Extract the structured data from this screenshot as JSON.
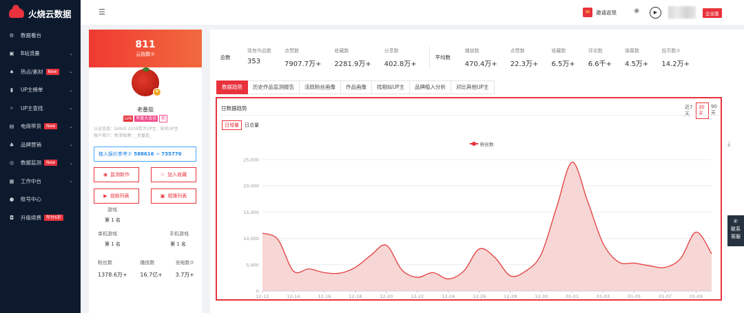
{
  "brand": {
    "name": "火烧云数据"
  },
  "sidebar": {
    "items": [
      {
        "icon": "dashboard-icon",
        "glyph": "⚙",
        "label": "数据看台",
        "chevron": false,
        "badge": ""
      },
      {
        "icon": "bilibili-icon",
        "glyph": "▣",
        "label": "B站流量",
        "chevron": true,
        "badge": ""
      },
      {
        "icon": "fire-icon",
        "glyph": "♠",
        "label": "热点/素材",
        "chevron": true,
        "badge": "New"
      },
      {
        "icon": "bar-chart-icon",
        "glyph": "▮",
        "label": "UP主榜单",
        "chevron": true,
        "badge": ""
      },
      {
        "icon": "search-icon",
        "glyph": "⌕",
        "label": "UP主查找",
        "chevron": true,
        "badge": ""
      },
      {
        "icon": "cart-icon",
        "glyph": "▤",
        "label": "电商带货",
        "chevron": true,
        "badge": "New"
      },
      {
        "icon": "brand-icon",
        "glyph": "♣",
        "label": "品牌营销",
        "chevron": true,
        "badge": ""
      },
      {
        "icon": "monitor-icon",
        "glyph": "◎",
        "label": "数据监测",
        "chevron": true,
        "badge": "New"
      },
      {
        "icon": "grid-icon",
        "glyph": "▦",
        "label": "工作中台",
        "chevron": true,
        "badge": ""
      },
      {
        "icon": "user-icon",
        "glyph": "●",
        "label": "账号中心",
        "chevron": false,
        "badge": ""
      },
      {
        "icon": "upgrade-icon",
        "glyph": "◘",
        "label": "升级续费",
        "chevron": false,
        "badge": "年付6折"
      }
    ]
  },
  "topbar": {
    "menu_glyph": "☰",
    "invite_label": "邀请返现",
    "gift_glyph": "✉",
    "palette_glyph": "❀",
    "avatar_glyph": "▶",
    "enterprise_label": "企业版"
  },
  "profile": {
    "fans_value": "811",
    "fans_label": "云指数⑦",
    "avatar_badge": "✦",
    "name": "老番茄",
    "tags": {
      "lv": "LV6",
      "vip": "年度大会员",
      "fan": "粉"
    },
    "cert_line1": "认证信息：bilibili 2019百大UP主、知名UP主",
    "cert_line2": "账户简介：新浪微博：_老番茄_",
    "quote_label": "植入报价参考⑦",
    "quote_value": "588616 ~ 735770",
    "buttons": {
      "monitor": "监测新作",
      "collect": "加入收藏",
      "videos": "视频列表",
      "album": "相簿列表"
    },
    "button_glyphs": {
      "monitor": "◉",
      "collect": "☆",
      "videos": "▶",
      "album": "▣"
    },
    "rank1": {
      "title": "游戏",
      "value": "第 1 名"
    },
    "rank2": [
      {
        "title": "单机游戏",
        "value": "第 1 名"
      },
      {
        "title": "手机游戏",
        "value": "第 1 名"
      }
    ],
    "stats": [
      {
        "label": "粉丝数",
        "value": "1378.6万+"
      },
      {
        "label": "播放数",
        "value": "16.7亿+"
      },
      {
        "label": "充电数⑦",
        "value": "3.7万+"
      }
    ]
  },
  "summary": {
    "total_label": "总数",
    "totals": [
      {
        "label": "现有作品数",
        "value": "353"
      },
      {
        "label": "点赞数",
        "value": "7907.7万+"
      },
      {
        "label": "收藏数",
        "value": "2281.9万+"
      },
      {
        "label": "分享数",
        "value": "402.8万+"
      }
    ],
    "avg_label": "平均数",
    "averages": [
      {
        "label": "播放数",
        "value": "470.4万+"
      },
      {
        "label": "点赞数",
        "value": "22.3万+"
      },
      {
        "label": "收藏数",
        "value": "6.5万+"
      },
      {
        "label": "评论数",
        "value": "6.6千+"
      },
      {
        "label": "弹幕数",
        "value": "4.5万+"
      },
      {
        "label": "投币数⑦",
        "value": "14.2万+"
      }
    ]
  },
  "tabs": [
    {
      "label": "数据趋势",
      "active": true
    },
    {
      "label": "历史作品监测报告",
      "active": false
    },
    {
      "label": "活跃粉丝画像",
      "active": false
    },
    {
      "label": "作品画像",
      "active": false
    },
    {
      "label": "找相似UP主",
      "active": false
    },
    {
      "label": "品牌植入分析",
      "active": false
    },
    {
      "label": "对比其他UP主",
      "active": false
    }
  ],
  "chart_panel": {
    "title": "日数据趋势",
    "ranges": [
      {
        "label": "近7天",
        "active": false
      },
      {
        "label": "30天",
        "active": true
      },
      {
        "label": "90天",
        "active": false
      }
    ],
    "metrics": [
      {
        "label": "日增量",
        "active": true
      },
      {
        "label": "日总量",
        "active": false
      }
    ],
    "download_glyph": "⤓"
  },
  "service": {
    "glyph": "✆",
    "line1": "联系",
    "line2": "客服"
  },
  "colors": {
    "accent": "#e8323c",
    "sidebar_bg": "#0d1a2e",
    "line": "#e23b3b",
    "area": "#f6cfcf"
  },
  "chart_data": {
    "type": "area",
    "legend": [
      "粉丝数"
    ],
    "ylim": [
      0,
      25000
    ],
    "yticks": [
      0,
      5000,
      10000,
      15000,
      20000,
      25000
    ],
    "ytick_labels": [
      "0",
      "5,000",
      "10,000",
      "15,000",
      "20,000",
      "25,000"
    ],
    "xtick_labels": [
      "12-12",
      "12-14",
      "12-16",
      "12-18",
      "12-20",
      "12-22",
      "12-24",
      "12-26",
      "12-28",
      "12-30",
      "01-01",
      "01-03",
      "01-05",
      "01-07",
      "01-09"
    ],
    "x": [
      "12-12",
      "12-13",
      "12-14",
      "12-15",
      "12-16",
      "12-17",
      "12-18",
      "12-19",
      "12-20",
      "12-21",
      "12-22",
      "12-23",
      "12-24",
      "12-25",
      "12-26",
      "12-27",
      "12-28",
      "12-29",
      "12-30",
      "12-31",
      "01-01",
      "01-02",
      "01-03",
      "01-04",
      "01-05",
      "01-06",
      "01-07",
      "01-08",
      "01-09",
      "01-10"
    ],
    "series": [
      {
        "name": "粉丝数",
        "values": [
          11000,
          9800,
          3800,
          4200,
          3500,
          3400,
          4500,
          6800,
          8700,
          4000,
          2600,
          3500,
          2300,
          3800,
          8000,
          6400,
          2900,
          3800,
          7000,
          16000,
          24500,
          17000,
          9000,
          5500,
          5300,
          4800,
          4500,
          6200,
          11200,
          7100
        ]
      }
    ]
  }
}
